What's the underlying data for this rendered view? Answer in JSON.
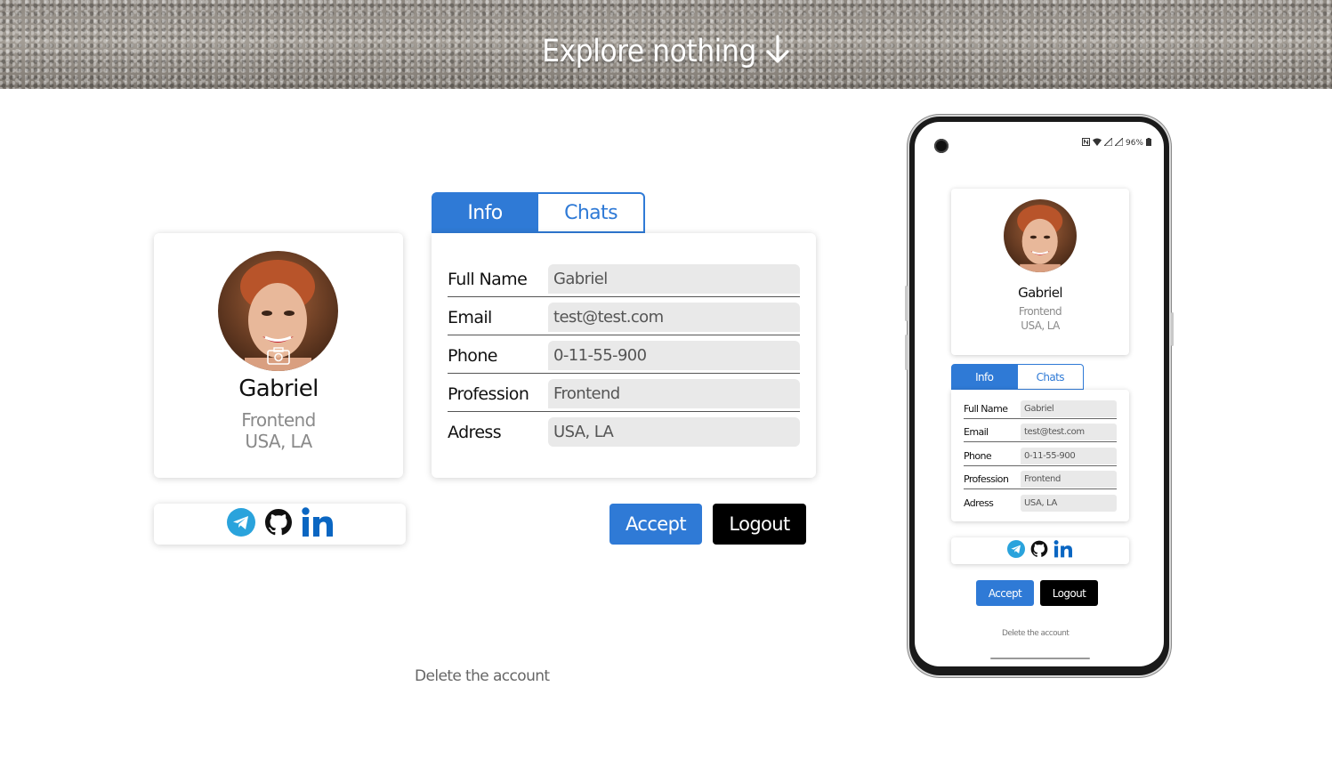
{
  "hero": {
    "title": "Explore nothing"
  },
  "profile": {
    "name": "Gabriel",
    "profession": "Frontend",
    "location": "USA, LA"
  },
  "tabs": {
    "info": "Info",
    "chats": "Chats"
  },
  "form": {
    "rows": [
      {
        "label": "Full Name",
        "value": "Gabriel"
      },
      {
        "label": "Email",
        "value": "test@test.com"
      },
      {
        "label": "Phone",
        "value": "0-11-55-900"
      },
      {
        "label": "Profession",
        "value": "Frontend"
      },
      {
        "label": "Adress",
        "value": "USA, LA"
      }
    ]
  },
  "buttons": {
    "accept": "Accept",
    "logout": "Logout"
  },
  "delete_account": "Delete the account",
  "phone": {
    "battery": "96%"
  },
  "social": [
    "telegram-icon",
    "github-icon",
    "linkedin-icon"
  ],
  "colors": {
    "accent": "#2f7ad6",
    "logout": "#000000",
    "telegram": "#2aa3dc",
    "linkedin": "#0a66c2"
  }
}
